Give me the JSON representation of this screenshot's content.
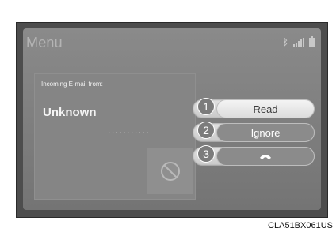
{
  "header": {
    "title": "Menu"
  },
  "status_icons": [
    "bluetooth-icon",
    "signal-bars-icon",
    "battery-icon"
  ],
  "notification": {
    "label": "Incoming E-mail from:",
    "sender": "Unknown",
    "masked": "...........",
    "block_icon": "prohibited-icon"
  },
  "actions": [
    {
      "number": "1",
      "label": "Read"
    },
    {
      "number": "2",
      "label": "Ignore"
    },
    {
      "number": "3",
      "label": "",
      "icon": "phone-icon"
    }
  ],
  "credit": "CLA51BX061US",
  "colors": {
    "frame": "#4d4d4d",
    "screen": "#858585",
    "button_active": "#ececec"
  }
}
